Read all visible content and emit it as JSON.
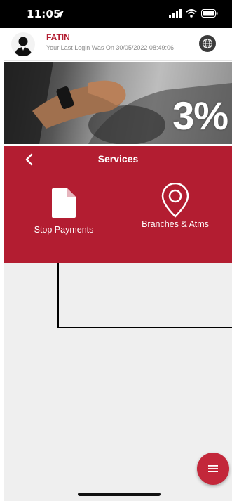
{
  "status_bar": {
    "time": "11:05"
  },
  "header": {
    "user_name": "FATIN",
    "last_login": "Your Last Login Was On 30/05/2022 08:49:06"
  },
  "banner": {
    "text": "3%"
  },
  "services": {
    "title": "Services",
    "items": [
      {
        "label": "Stop Payments",
        "icon": "document-icon"
      },
      {
        "label": "Branches & Atms",
        "icon": "location-pin-icon"
      }
    ]
  },
  "colors": {
    "brand_red": "#b31d31",
    "background": "#efefef"
  }
}
